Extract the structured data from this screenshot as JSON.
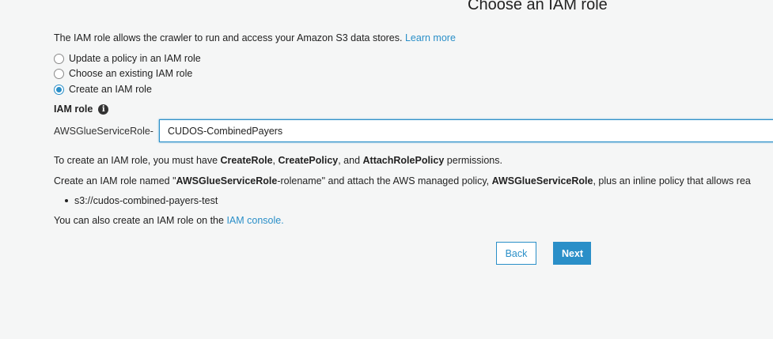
{
  "title": "Choose an IAM role",
  "intro": {
    "text": "The IAM role allows the crawler to run and access your Amazon S3 data stores.",
    "learn_more": "Learn more"
  },
  "options": [
    {
      "label": "Update a policy in an IAM role",
      "selected": false
    },
    {
      "label": "Choose an existing IAM role",
      "selected": false
    },
    {
      "label": "Create an IAM role",
      "selected": true
    }
  ],
  "role": {
    "label": "IAM role",
    "prefix": "AWSGlueServiceRole-",
    "value": "CUDOS-CombinedPayers"
  },
  "permissions": {
    "p1": "To create an IAM role, you must have ",
    "b1": "CreateRole",
    "p2": ", ",
    "b2": "CreatePolicy",
    "p3": ", and ",
    "b3": "AttachRolePolicy",
    "p4": " permissions."
  },
  "create_desc": {
    "p1": "Create an IAM role named \"",
    "b1": "AWSGlueServiceRole",
    "p2": "-rolename\" and attach the AWS managed policy, ",
    "b2": "AWSGlueServiceRole",
    "p3": ", plus an inline policy that allows rea"
  },
  "s3_paths": [
    "s3://cudos-combined-payers-test"
  ],
  "console": {
    "text": "You can also create an IAM role on the ",
    "link": "IAM console."
  },
  "buttons": {
    "back": "Back",
    "next": "Next"
  },
  "colors": {
    "accent": "#2a8fc8",
    "background": "#f5f6f6"
  }
}
